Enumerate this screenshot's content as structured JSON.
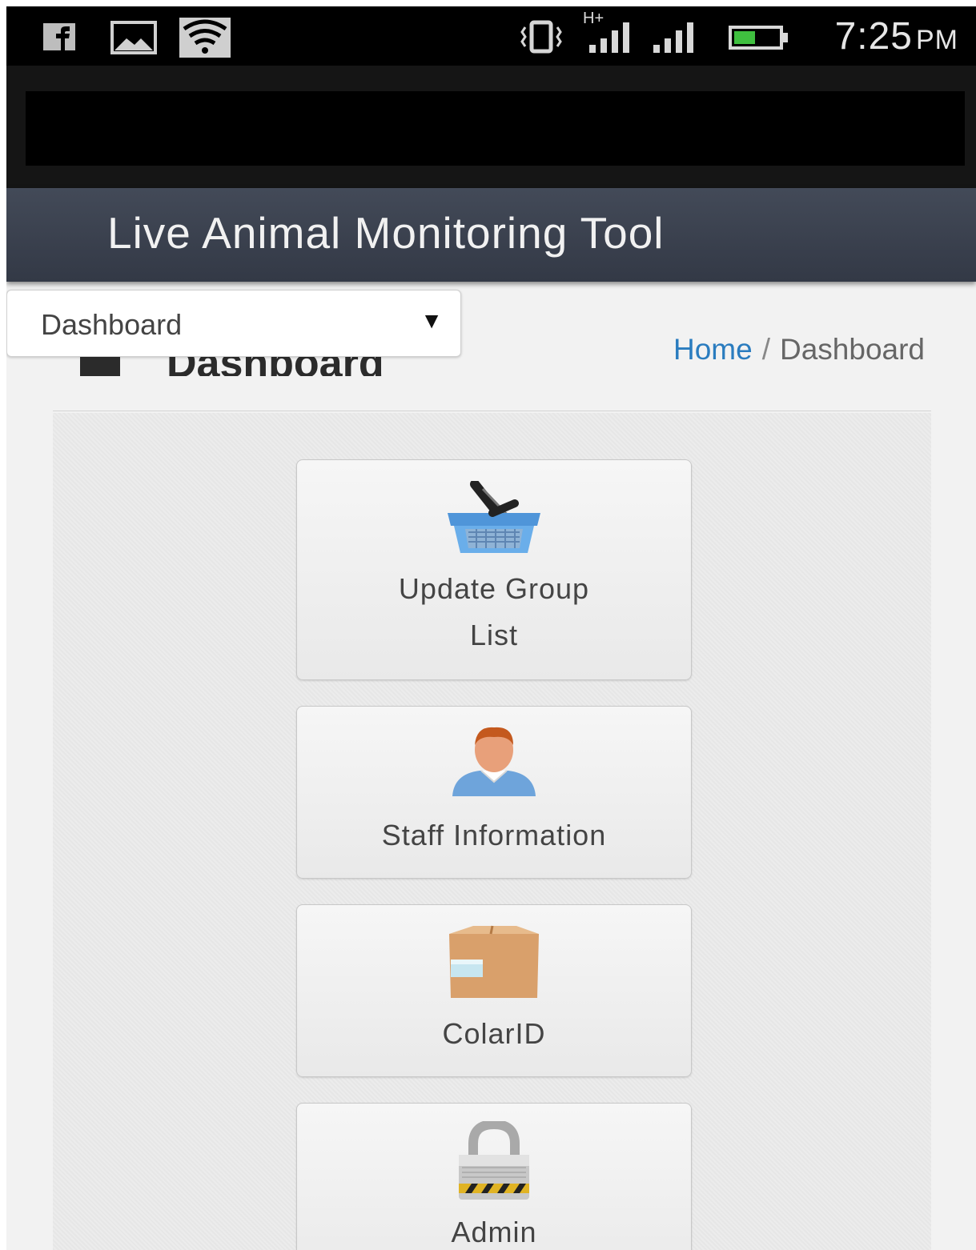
{
  "status_bar": {
    "time": "7:25",
    "ampm": "PM",
    "network_label": "H+",
    "left_icons": [
      "facebook-icon",
      "image-icon",
      "wifi-icon"
    ],
    "right_icons": [
      "vibrate-icon",
      "signal-icon",
      "signal-icon",
      "battery-icon"
    ]
  },
  "header": {
    "title": "Live Animal Monitoring Tool"
  },
  "nav": {
    "selected": "Dashboard",
    "arrow": "▼"
  },
  "page": {
    "heading_partial": "Dashboard"
  },
  "breadcrumb": {
    "home": "Home",
    "separator": "/",
    "current": "Dashboard"
  },
  "tiles": [
    {
      "label_line1": "Update Group",
      "label_line2": "List",
      "icon": "basket-icon"
    },
    {
      "label": "Staff Information",
      "icon": "user-icon"
    },
    {
      "label": "ColarID",
      "icon": "box-icon"
    },
    {
      "label": "Admin",
      "icon": "lock-icon"
    }
  ],
  "colors": {
    "header_bg": "#3a404d",
    "link": "#2a7cbf",
    "status_bar": "#000000"
  }
}
